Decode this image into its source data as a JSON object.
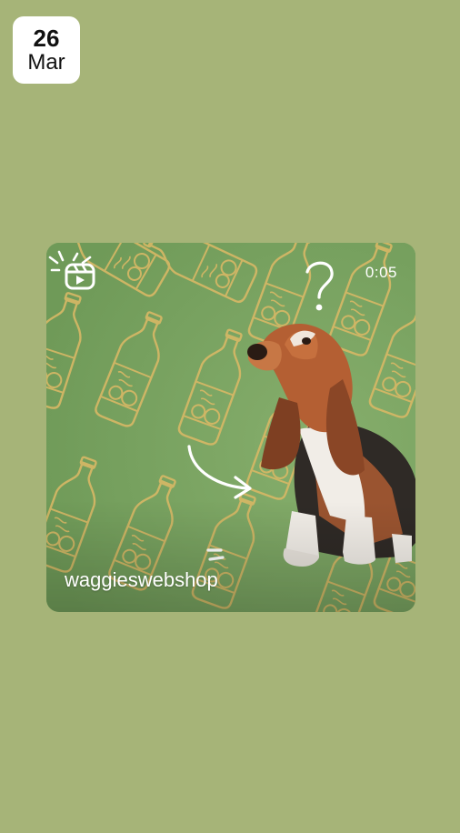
{
  "date": {
    "day": "26",
    "month": "Mar"
  },
  "post": {
    "duration": "0:05",
    "username": "waggieswebshop",
    "type_icon": "reels-icon"
  },
  "colors": {
    "page_background": "#a6b478",
    "card_background": "#7aa362",
    "pattern_stroke": "#d9b866",
    "badge_background": "#ffffff"
  }
}
